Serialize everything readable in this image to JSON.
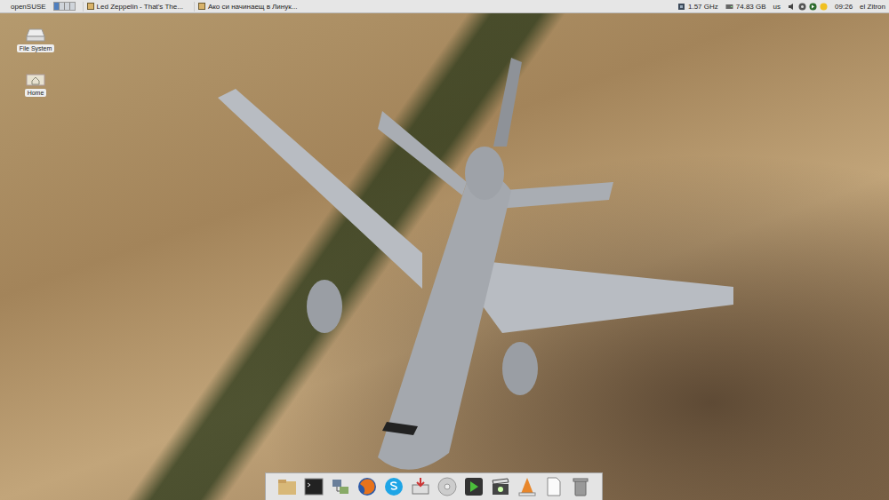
{
  "panel": {
    "menu": "openSUSE",
    "workspaces": [
      {
        "selected": true
      },
      {
        "selected": false
      },
      {
        "selected": false
      },
      {
        "selected": false
      }
    ],
    "tasks": [
      {
        "label": "Led Zeppelin - That's The...",
        "selected": false
      },
      {
        "label": "Ако си начинаещ в Линук...",
        "selected": false
      }
    ],
    "cpu": "1.57 GHz",
    "disk": "74.83 GB",
    "keyboard": "us",
    "clock": "09:26",
    "user": "el Zitron"
  },
  "desktop_icons": [
    {
      "label": "File System",
      "kind": "drive"
    },
    {
      "label": "Home",
      "kind": "home"
    }
  ],
  "dock": {
    "items": [
      {
        "kind": "files"
      },
      {
        "kind": "terminal"
      },
      {
        "kind": "network"
      },
      {
        "kind": "firefox"
      },
      {
        "kind": "skype"
      },
      {
        "kind": "installer"
      },
      {
        "kind": "disc"
      },
      {
        "kind": "player"
      },
      {
        "kind": "video"
      },
      {
        "kind": "cone"
      },
      {
        "kind": "document"
      },
      {
        "kind": "trash"
      }
    ]
  }
}
